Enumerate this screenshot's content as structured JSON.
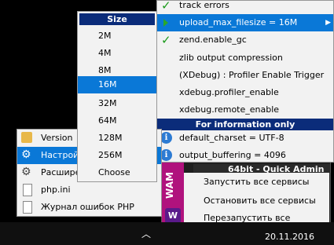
{
  "dark_menu": {
    "header": "64bit - Quick Admin",
    "items": [
      "Запустить все сервисы",
      "Остановить все сервисы",
      "Перезапустить все сервисы"
    ],
    "brand_text": "WAM"
  },
  "php_settings": {
    "items": [
      {
        "label": "track errors",
        "mark": "check"
      },
      {
        "label": "upload_max_filesize = 16M",
        "mark": "arrow",
        "selected": true
      },
      {
        "label": "zend.enable_gc",
        "mark": "check"
      },
      {
        "label": "zlib output compression",
        "mark": "none"
      },
      {
        "label": "(XDebug) : Profiler Enable Trigger",
        "mark": "none"
      },
      {
        "label": "xdebug.profiler_enable",
        "mark": "none"
      },
      {
        "label": "xdebug.remote_enable",
        "mark": "none"
      }
    ],
    "section_header": "For information only",
    "info_items": [
      "default_charset = UTF-8",
      "output_buffering = 4096"
    ]
  },
  "size_menu": {
    "header": "Size",
    "options": [
      "2M",
      "4M",
      "8M",
      "16M",
      "32M",
      "64M",
      "128M",
      "256M",
      "Choose"
    ],
    "selected": "16M"
  },
  "left_menu": {
    "items": [
      {
        "label": "Version",
        "icon": "folder-icon"
      },
      {
        "label": "Настрой",
        "icon": "gear-icon",
        "selected": true
      },
      {
        "label": "Расшире",
        "icon": "gear-icon"
      },
      {
        "label": "php.ini",
        "icon": "document-icon"
      },
      {
        "label": "Журнал ошибок PHP",
        "icon": "document-icon"
      }
    ]
  },
  "taskbar": {
    "date": "20.11.2016"
  },
  "colors": {
    "accent": "#0a78d7",
    "header": "#0b2c7a",
    "check": "#1a9a1a"
  }
}
